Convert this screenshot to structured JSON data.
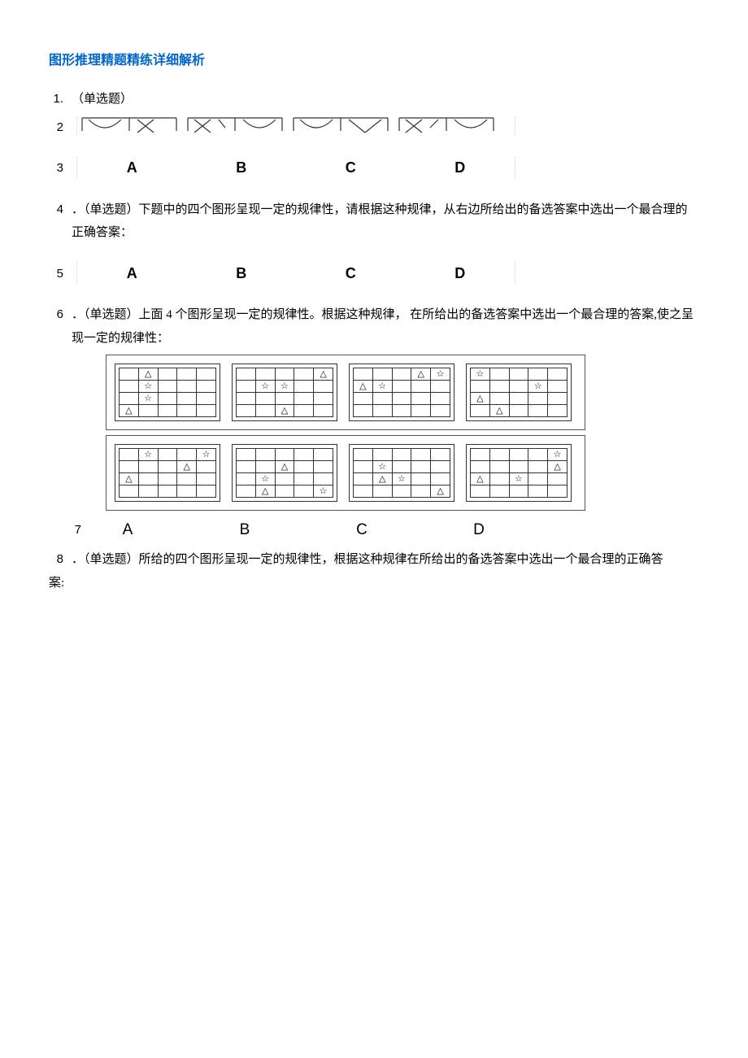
{
  "title": "图形推理精题精练详细解析",
  "q1": {
    "num": "1.",
    "label": "（单选题）"
  },
  "row2": "2",
  "row3": "3",
  "row5": "5",
  "row7": "7",
  "options": {
    "A": "A",
    "B": "B",
    "C": "C",
    "D": "D"
  },
  "q4": {
    "num": "4",
    "text": "．（单选题）下题中的四个图形呈现一定的规律性，请根据这种规律，从右边所给出的备选答案中选出一个最合理的正确答案："
  },
  "q6": {
    "num": "6",
    "text": "．（单选题）上面 4 个图形呈现一定的规律性。根据这种规律， 在所给出的备选答案中选出一个最合理的答案,使之呈现一定的规律性："
  },
  "q8": {
    "num": "8",
    "text": "．（单选题）所给的四个图形呈现一定的规律性，根据这种规律在所给出的备选答案中选出一个最合理的正确答",
    "tail": "案:"
  },
  "grids_top": [
    [
      [
        null,
        "△",
        null,
        null,
        null
      ],
      [
        null,
        "☆",
        null,
        null,
        null
      ],
      [
        null,
        "☆",
        null,
        null,
        null
      ],
      [
        "△",
        null,
        null,
        null,
        null
      ]
    ],
    [
      [
        null,
        null,
        null,
        null,
        "△"
      ],
      [
        null,
        "☆",
        "☆",
        null,
        null
      ],
      [
        null,
        null,
        null,
        null,
        null
      ],
      [
        null,
        null,
        "△",
        null,
        null
      ]
    ],
    [
      [
        null,
        null,
        null,
        "△",
        "☆"
      ],
      [
        "△",
        "☆",
        null,
        null,
        null
      ],
      [
        null,
        null,
        null,
        null,
        null
      ],
      [
        null,
        null,
        null,
        null,
        null
      ]
    ],
    [
      [
        "☆",
        null,
        null,
        null,
        null
      ],
      [
        null,
        null,
        null,
        "☆",
        null
      ],
      [
        "△",
        null,
        null,
        null,
        null
      ],
      [
        null,
        "△",
        null,
        null,
        null
      ]
    ]
  ],
  "grids_bottom": [
    [
      [
        null,
        "☆",
        null,
        null,
        "☆"
      ],
      [
        null,
        null,
        null,
        "△",
        null
      ],
      [
        "△",
        null,
        null,
        null,
        null
      ],
      [
        null,
        null,
        null,
        null,
        null
      ]
    ],
    [
      [
        null,
        null,
        null,
        null,
        null
      ],
      [
        null,
        null,
        "△",
        null,
        null
      ],
      [
        null,
        "☆",
        null,
        null,
        null
      ],
      [
        null,
        "△",
        null,
        null,
        "☆"
      ]
    ],
    [
      [
        null,
        null,
        null,
        null,
        null
      ],
      [
        null,
        "☆",
        null,
        null,
        null
      ],
      [
        null,
        "△",
        "☆",
        null,
        null
      ],
      [
        null,
        null,
        null,
        null,
        "△"
      ]
    ],
    [
      [
        null,
        null,
        null,
        null,
        "☆"
      ],
      [
        null,
        null,
        null,
        null,
        "△"
      ],
      [
        "△",
        null,
        "☆",
        null,
        null
      ],
      [
        null,
        null,
        null,
        null,
        null
      ]
    ]
  ]
}
